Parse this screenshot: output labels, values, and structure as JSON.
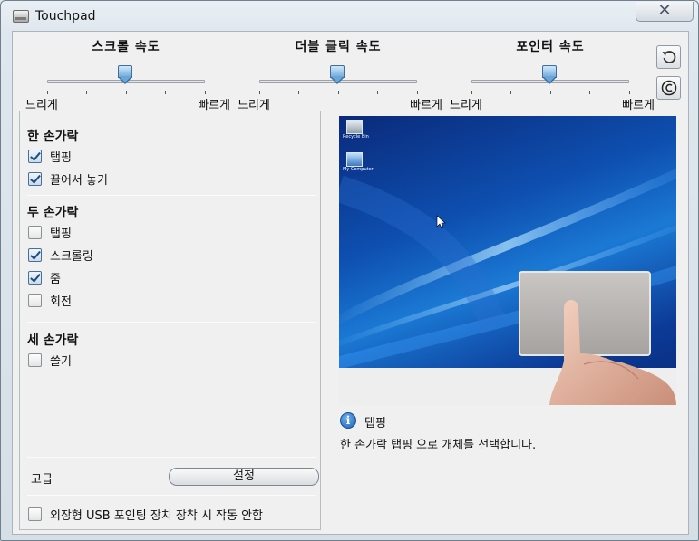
{
  "window": {
    "title": "Touchpad",
    "close_glyph": "✕"
  },
  "sliders": [
    {
      "title": "스크롤 속도",
      "slow": "느리게",
      "fast": "빠르게",
      "position_fraction": 0.5
    },
    {
      "title": "더블 클릭 속도",
      "slow": "느리게",
      "fast": "빠르게",
      "position_fraction": 0.5
    },
    {
      "title": "포인터 속도",
      "slow": "느리게",
      "fast": "빠르게",
      "position_fraction": 0.5
    }
  ],
  "side_buttons": [
    {
      "name": "reset",
      "icon": "undo-arrow-icon"
    },
    {
      "name": "about",
      "icon": "copyright-icon"
    }
  ],
  "gestures": {
    "one_finger": {
      "title": "한 손가락",
      "options": [
        {
          "label": "탭핑",
          "checked": true
        },
        {
          "label": "끌어서 놓기",
          "checked": true
        }
      ]
    },
    "two_fingers": {
      "title": "두 손가락",
      "options": [
        {
          "label": "탭핑",
          "checked": false
        },
        {
          "label": "스크롤링",
          "checked": true
        },
        {
          "label": "줌",
          "checked": true
        },
        {
          "label": "회전",
          "checked": false
        }
      ]
    },
    "three_fingers": {
      "title": "세 손가락",
      "options": [
        {
          "label": "쓸기",
          "checked": false
        }
      ]
    }
  },
  "advanced": {
    "label": "고급",
    "settings_button": "설정"
  },
  "external_usb": {
    "label": "외장형 USB 포인팅 장치 장착 시 작동 안함",
    "checked": false
  },
  "preview": {
    "desktop_icons": [
      {
        "label": "Recycle Bin"
      },
      {
        "label": "My Computer"
      }
    ]
  },
  "info": {
    "title": "탭핑",
    "description": "한 손가락 탭핑 으로 개체를 선택합니다."
  }
}
